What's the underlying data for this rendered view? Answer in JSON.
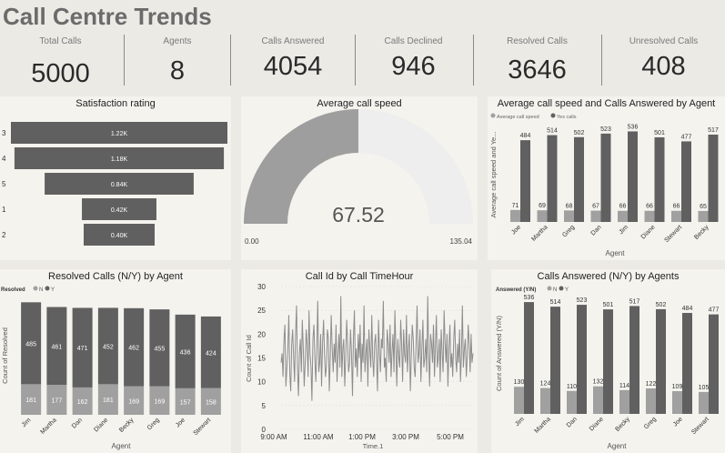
{
  "title": "Call Centre Trends",
  "kpis": [
    {
      "label": "Total Calls",
      "value": "5000"
    },
    {
      "label": "Agents",
      "value": "8"
    },
    {
      "label": "Calls Answered",
      "value": "4054"
    },
    {
      "label": "Calls Declined",
      "value": "946"
    },
    {
      "label": "Resolved Calls",
      "value": "3646"
    },
    {
      "label": "Unresolved Calls",
      "value": "408"
    }
  ],
  "colors": {
    "dark": "#606060",
    "light": "#a0a0a0",
    "gauge_fill": "#9e9e9e",
    "gauge_bg": "#eeeeee"
  },
  "chart_data": [
    {
      "type": "bar",
      "title": "Satisfaction rating",
      "orientation": "funnel",
      "categories": [
        "3",
        "4",
        "5",
        "1",
        "2"
      ],
      "values": [
        1220,
        1180,
        840,
        420,
        400
      ],
      "labels": [
        "1.22K",
        "1.18K",
        "0.84K",
        "0.42K",
        "0.40K"
      ]
    },
    {
      "type": "gauge",
      "title": "Average call speed",
      "value": 67.52,
      "value_label": "67.52",
      "min_label": "0.00",
      "max_label": "135.04",
      "range": [
        0,
        135.04
      ]
    },
    {
      "type": "bar",
      "title": "Average call speed and Calls Answered by Agent",
      "categories": [
        "Joe",
        "Martha",
        "Greg",
        "Dan",
        "Jim",
        "Diane",
        "Stewart",
        "Becky"
      ],
      "legend": [
        "Average call speed",
        "Yes calls"
      ],
      "series": [
        {
          "name": "Average call speed",
          "values": [
            71,
            69,
            68,
            67,
            66,
            66,
            66,
            65
          ]
        },
        {
          "name": "Yes calls",
          "values": [
            484,
            514,
            502,
            523,
            536,
            501,
            477,
            517
          ]
        }
      ],
      "xlabel": "Agent",
      "ylabel": "Average call speed and Ye...",
      "ylim": [
        0,
        560
      ]
    },
    {
      "type": "bar",
      "stacked": true,
      "title": "Resolved Calls (N/Y) by Agent",
      "legend_title": "Resolved",
      "legend": [
        "N",
        "Y"
      ],
      "categories": [
        "Jim",
        "Martha",
        "Dan",
        "Diane",
        "Becky",
        "Greg",
        "Joe",
        "Stewart"
      ],
      "series": [
        {
          "name": "N",
          "values": [
            181,
            177,
            162,
            181,
            169,
            169,
            157,
            158
          ]
        },
        {
          "name": "Y",
          "values": [
            485,
            461,
            471,
            452,
            462,
            455,
            436,
            424
          ]
        }
      ],
      "xlabel": "Agent",
      "ylabel": "Count of Resolved",
      "ylim": [
        0,
        700
      ]
    },
    {
      "type": "line",
      "title": "Call Id by Call TimeHour",
      "xlabel": "Time.1",
      "ylabel": "Count of Call Id",
      "ylim": [
        0,
        30
      ],
      "yticks": [
        0,
        5,
        10,
        15,
        20,
        25,
        30
      ],
      "xticks": [
        "9:00 AM",
        "11:00 AM",
        "1:00 PM",
        "3:00 PM",
        "5:00 PM"
      ],
      "y": [
        14,
        16,
        11,
        19,
        22,
        9,
        13,
        17,
        24,
        12,
        8,
        18,
        21,
        15,
        10,
        20,
        26,
        13,
        7,
        16,
        19,
        12,
        23,
        17,
        9,
        14,
        21,
        18,
        11,
        25,
        16,
        13,
        6,
        19,
        22,
        15,
        10,
        17,
        27,
        12,
        14,
        20,
        9,
        18,
        23,
        16,
        11,
        13,
        21,
        19,
        8,
        15,
        24,
        17,
        12,
        18,
        14,
        22,
        10,
        16,
        20,
        13,
        28,
        11,
        17,
        19,
        9,
        15,
        23,
        18,
        12,
        14,
        21,
        16,
        7,
        19,
        25,
        13,
        17,
        11,
        20,
        15,
        22,
        10,
        18,
        14,
        26,
        12,
        16,
        19,
        9,
        21,
        17,
        13,
        24,
        15,
        11,
        18,
        20,
        14,
        8,
        23,
        16,
        12,
        19,
        17,
        27,
        13,
        15,
        10,
        21,
        18,
        14,
        22,
        11,
        16,
        20,
        12,
        25,
        17,
        9,
        19,
        15,
        13,
        23,
        18,
        10,
        21,
        16,
        14,
        24,
        12,
        17,
        20,
        8,
        15,
        22,
        19,
        13,
        11,
        18,
        26,
        14,
        16,
        21,
        10,
        17,
        23,
        13,
        15,
        19,
        12,
        28,
        16,
        9,
        20,
        18,
        14,
        22,
        11,
        17,
        24,
        13,
        15,
        19,
        10,
        21,
        16,
        12,
        25,
        18,
        14,
        20,
        9,
        17,
        22,
        13,
        16,
        11,
        19,
        23,
        15,
        12,
        18,
        14,
        21,
        10,
        16,
        26,
        13,
        17,
        19,
        11,
        15,
        22,
        18,
        12,
        20,
        14,
        16
      ]
    },
    {
      "type": "bar",
      "title": "Calls Answered (N/Y) by Agents",
      "legend_title": "Answered (Y/N)",
      "legend": [
        "N",
        "Y"
      ],
      "categories": [
        "Jim",
        "Martha",
        "Dan",
        "Diane",
        "Becky",
        "Greg",
        "Joe",
        "Stewart"
      ],
      "series": [
        {
          "name": "N",
          "values": [
            130,
            124,
            110,
            132,
            114,
            122,
            109,
            105
          ]
        },
        {
          "name": "Y",
          "values": [
            536,
            514,
            523,
            501,
            517,
            502,
            484,
            477
          ]
        }
      ],
      "xlabel": "Agent",
      "ylabel": "Count of Answered (Y/N)",
      "ylim": [
        0,
        580
      ]
    }
  ]
}
